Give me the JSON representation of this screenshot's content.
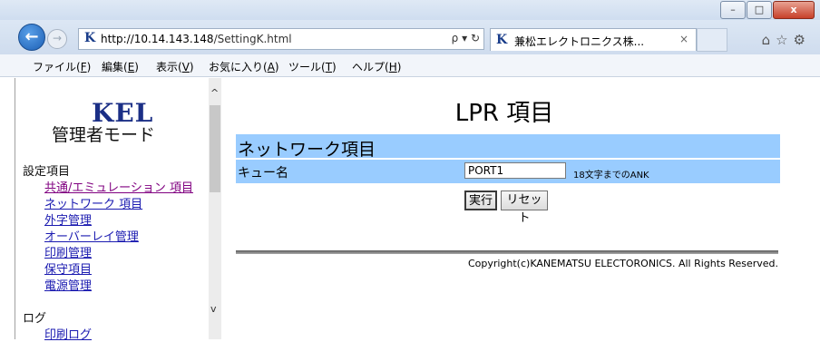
{
  "browser": {
    "window_controls": {
      "minimize": "–",
      "maximize": "□",
      "close": "x"
    },
    "url_host": "http://10.14.143.148",
    "url_path": "/SettingK.html",
    "address_icons": "ρ ▾ ↻",
    "tab_title": "兼松エレクトロニクス株...",
    "tab_close": "×",
    "favicon": "K",
    "back_icon": "←",
    "forward_icon": "→",
    "toolbar_icons": "⌂☆⚙",
    "menu": [
      {
        "label": "ファイル(",
        "key": "F",
        "end": ")"
      },
      {
        "label": "編集(",
        "key": "E",
        "end": ")"
      },
      {
        "label": "表示(",
        "key": "V",
        "end": ")"
      },
      {
        "label": "お気に入り(",
        "key": "A",
        "end": ")"
      },
      {
        "label": "ツール(",
        "key": "T",
        "end": ")"
      },
      {
        "label": "ヘルプ(",
        "key": "H",
        "end": ")"
      }
    ]
  },
  "sidebar": {
    "logo": "KEL",
    "mode_title": "管理者モード",
    "settings_heading": "設定項目",
    "settings_links": [
      "共通/エミュレーション 項目",
      "ネットワーク 項目",
      "外字管理",
      "オーバーレイ管理",
      "印刷管理",
      "保守項目",
      "電源管理"
    ],
    "log_heading": "ログ",
    "log_links": [
      "印刷ログ"
    ],
    "scroll_up": "^",
    "scroll_down": "v"
  },
  "main": {
    "page_title": "LPR 項目",
    "section_title": "ネットワーク項目",
    "queue_label": "キュー名",
    "queue_value": "PORT1",
    "queue_hint": "18文字までのANK",
    "run_button": "実行",
    "reset_button": "リセット",
    "copyright": "Copyright(c)KANEMATSU ELECTORONICS. All Rights Reserved."
  }
}
